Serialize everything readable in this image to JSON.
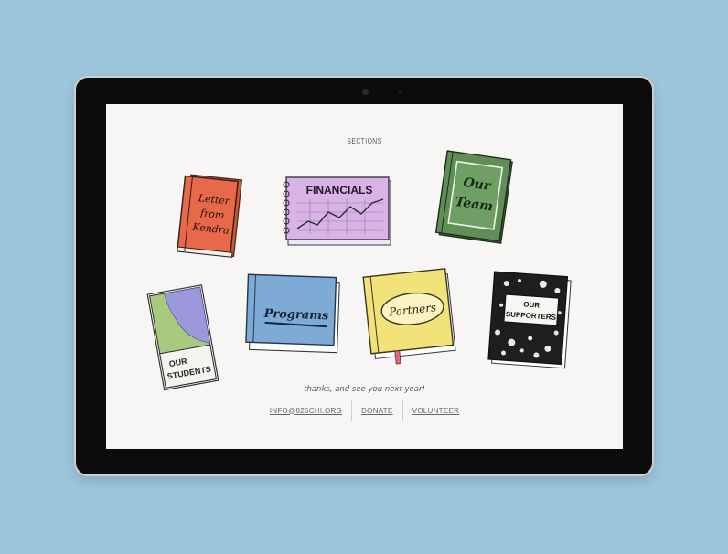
{
  "page": {
    "heading": "SECTIONS",
    "thanks": "thanks, and see you next year!"
  },
  "books": [
    {
      "id": "letter",
      "lines": [
        "Letter",
        "from",
        "Kendra"
      ],
      "color": "#e8694a",
      "icon": "book-letter-from-kendra"
    },
    {
      "id": "financials",
      "lines": [
        "FINANCIALS"
      ],
      "color": "#d9b3e6",
      "icon": "notebook-financials"
    },
    {
      "id": "team",
      "lines": [
        "Our",
        "Team"
      ],
      "color": "#5f8f56",
      "icon": "book-our-team"
    },
    {
      "id": "students",
      "lines": [
        "OUR",
        "STUDENTS"
      ],
      "color": "#a9c97e",
      "icon": "book-our-students"
    },
    {
      "id": "programs",
      "lines": [
        "Programs"
      ],
      "color": "#7eaad6",
      "icon": "book-programs"
    },
    {
      "id": "partners",
      "lines": [
        "Partners"
      ],
      "color": "#f2e27a",
      "icon": "book-partners"
    },
    {
      "id": "supporters",
      "lines": [
        "OUR",
        "SUPPORTERS"
      ],
      "color": "#1e1e1e",
      "icon": "composition-notebook-our-supporters"
    }
  ],
  "footer": {
    "links": [
      "INFO@826CHI.ORG",
      "DONATE",
      "VOLUNTEER"
    ]
  }
}
